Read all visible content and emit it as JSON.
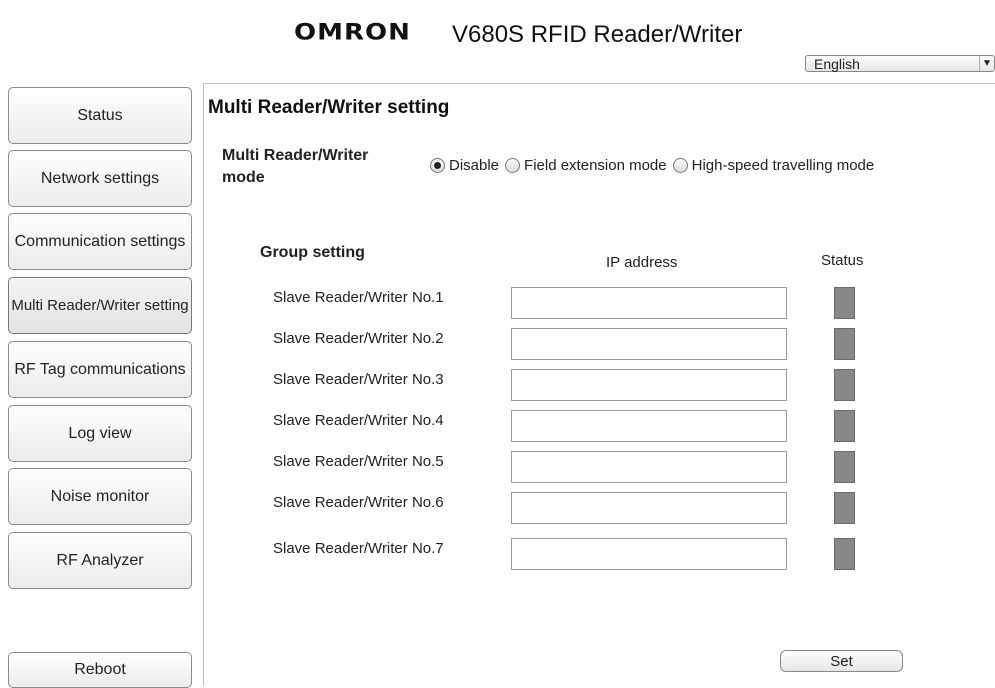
{
  "header": {
    "logo": "OMRON",
    "title": "V680S RFID Reader/Writer",
    "language": {
      "selected": "English"
    }
  },
  "sidebar": {
    "items": [
      {
        "label": "Status"
      },
      {
        "label": "Network settings"
      },
      {
        "label": "Communication settings"
      },
      {
        "label": "Multi Reader/Writer setting",
        "active": true
      },
      {
        "label": "RF Tag communications"
      },
      {
        "label": "Log view"
      },
      {
        "label": "Noise monitor"
      },
      {
        "label": "RF Analyzer"
      }
    ],
    "reboot_label": "Reboot"
  },
  "main": {
    "title": "Multi Reader/Writer setting",
    "mode": {
      "label": "Multi Reader/Writer mode",
      "options": [
        {
          "label": "Disable",
          "checked": true
        },
        {
          "label": "Field extension mode",
          "checked": false
        },
        {
          "label": "High-speed travelling mode",
          "checked": false
        }
      ]
    },
    "group": {
      "heading": "Group setting",
      "ip_header": "IP address",
      "status_header": "Status",
      "rows": [
        {
          "label": "Slave Reader/Writer No.1",
          "ip": ""
        },
        {
          "label": "Slave Reader/Writer No.2",
          "ip": ""
        },
        {
          "label": "Slave Reader/Writer No.3",
          "ip": ""
        },
        {
          "label": "Slave Reader/Writer No.4",
          "ip": ""
        },
        {
          "label": "Slave Reader/Writer No.5",
          "ip": ""
        },
        {
          "label": "Slave Reader/Writer No.6",
          "ip": ""
        },
        {
          "label": "Slave Reader/Writer No.7",
          "ip": ""
        }
      ]
    },
    "set_label": "Set"
  },
  "colors": {
    "status_lamp_off": "#888888",
    "divider": "#bdbdbd"
  }
}
